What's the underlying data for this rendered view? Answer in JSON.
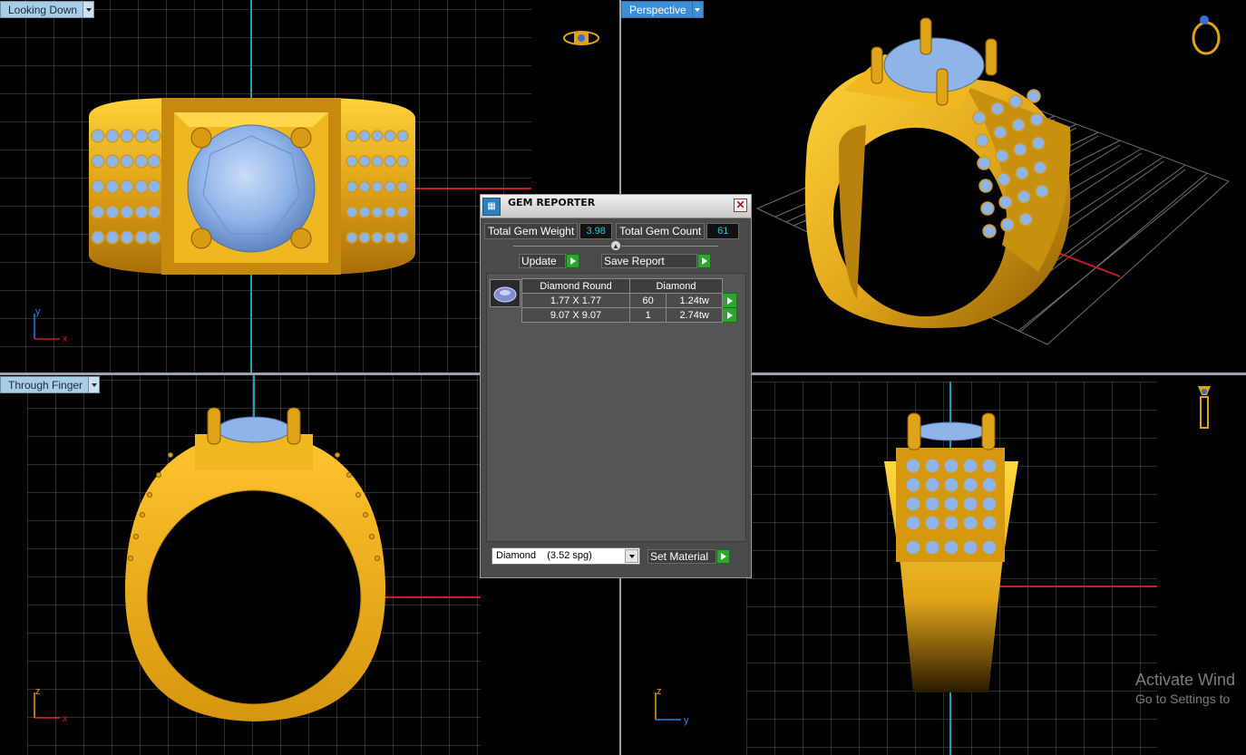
{
  "viewports": {
    "top_left": {
      "label": "Looking Down",
      "axes": [
        "y",
        "x"
      ]
    },
    "top_right": {
      "label": "Perspective"
    },
    "bottom_left": {
      "label": "Through Finger",
      "axes": [
        "z",
        "x"
      ]
    },
    "bottom_right": {
      "axes": [
        "z",
        "y"
      ]
    }
  },
  "gem_reporter": {
    "title": "GEM REPORTER",
    "close_label": "✕",
    "total_weight_label": "Total Gem Weight",
    "total_weight_value": "3.98",
    "total_count_label": "Total Gem Count",
    "total_count_value": "61",
    "update_label": "Update",
    "save_report_label": "Save Report",
    "table": {
      "headers": [
        "Diamond Round",
        "Diamond"
      ],
      "rows": [
        {
          "size": "1.77 X 1.77",
          "count": "60",
          "weight": "1.24tw"
        },
        {
          "size": "9.07 X 9.07",
          "count": "1",
          "weight": "2.74tw"
        }
      ]
    },
    "material_select": "Diamond    (3.52 spg)",
    "set_material_label": "Set Material"
  },
  "watermark": {
    "line1": "Activate Wind",
    "line2": "Go to Settings to"
  },
  "colors": {
    "gold": "#e0a419",
    "gem": "#8fb4e8",
    "grid": "#5a5a5a",
    "axis_red": "#c81e1e",
    "axis_cyan": "#1ea0b4"
  }
}
